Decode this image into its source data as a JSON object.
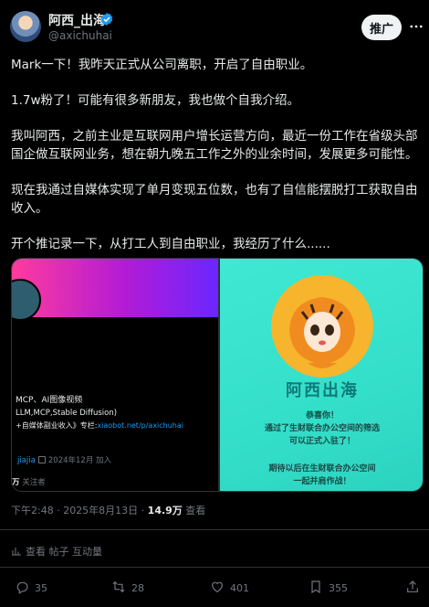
{
  "header": {
    "name": "阿西_出海",
    "handle": "@axichuhai",
    "promote_label": "推广"
  },
  "post": {
    "paragraphs": [
      "Mark一下！我昨天正式从公司离职，开启了自由职业。",
      "1.7w粉了！可能有很多新朋友，我也做个自我介绍。",
      "我叫阿西，之前主业是互联网用户增长运营方向，最近一份工作在省级头部国企做互联网业务，想在朝九晚五工作之外的业余时间，发展更多可能性。",
      "现在我通过自媒体实现了单月变现五位数，也有了自信能摆脱打工获取自由收入。",
      "开个推记录一下，从打工人到自由职业，我经历了什么......"
    ]
  },
  "media_left": {
    "line1": "MCP、AI图像视频",
    "line2": "LLM,MCP,Stable Diffusion)",
    "line3_prefix": "+自媒体副业收入》专栏:",
    "line3_link": "xiaobot.net/p/axichuhai",
    "meta_user": "jiajia",
    "meta_joined": "2024年12月 加入",
    "followers_num": "万",
    "followers_label": "关注者"
  },
  "media_right": {
    "title": "阿西出海",
    "line1": "恭喜你！",
    "line2": "通过了生财联合办公空间的筛选",
    "line3": "可以正式入驻了！",
    "line4": "期待以后在生财联合办公空间",
    "line5": "一起并肩作战！"
  },
  "timestamp": {
    "time": "下午2:48 · 2025年8月13日 · ",
    "views_num": "14.9万",
    "views_label": " 查看"
  },
  "insights": {
    "label": "查看 帖子 互动量"
  },
  "actions": {
    "replies": "35",
    "reposts": "28",
    "likes": "401",
    "views": "355"
  },
  "colors": {
    "background": "#000000",
    "text": "#e7e9ea",
    "muted": "#71767b",
    "accent": "#1d9bf0",
    "divider": "#2f3336",
    "teal": "#3fe8d2"
  }
}
